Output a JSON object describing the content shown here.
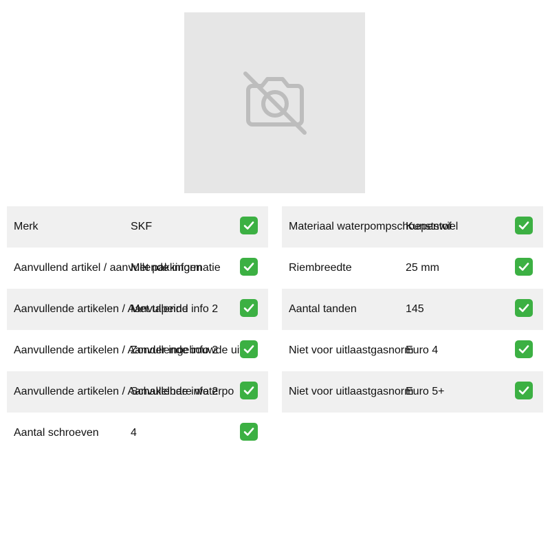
{
  "image": {
    "icon": "no-photo-icon"
  },
  "left_table": [
    {
      "label": "Merk",
      "value": "SKF"
    },
    {
      "label": "Aanvullend artikel / aanvullende informatie",
      "value": "Met pakkingen"
    },
    {
      "label": "Aanvullende artikelen / Aanvullende info 2",
      "value": "Met tapeind"
    },
    {
      "label": "Aanvullende artikelen / Aanvullende info 2",
      "value": "Zonder ingebouwde uitch"
    },
    {
      "label": "Aanvullende artikelen / Aanvullende info 2",
      "value": "Schakelbare waterpo"
    },
    {
      "label": "Aantal schroeven",
      "value": "4"
    }
  ],
  "right_table": [
    {
      "label": "Materiaal waterpompschoepenwiel",
      "value": "Kunststof"
    },
    {
      "label": "Riembreedte",
      "value": "25 mm"
    },
    {
      "label": "Aantal tanden",
      "value": "145"
    },
    {
      "label": "Niet voor uitlaastgasnorm",
      "value": "Euro 4"
    },
    {
      "label": "Niet voor uitlaastgasnorm",
      "value": "Euro 5+"
    }
  ],
  "status_icon": "check-mark-icon",
  "colors": {
    "row_alt": "#f0f0f0",
    "check": "#3cb043",
    "photo_bg": "#e6e6e6"
  }
}
